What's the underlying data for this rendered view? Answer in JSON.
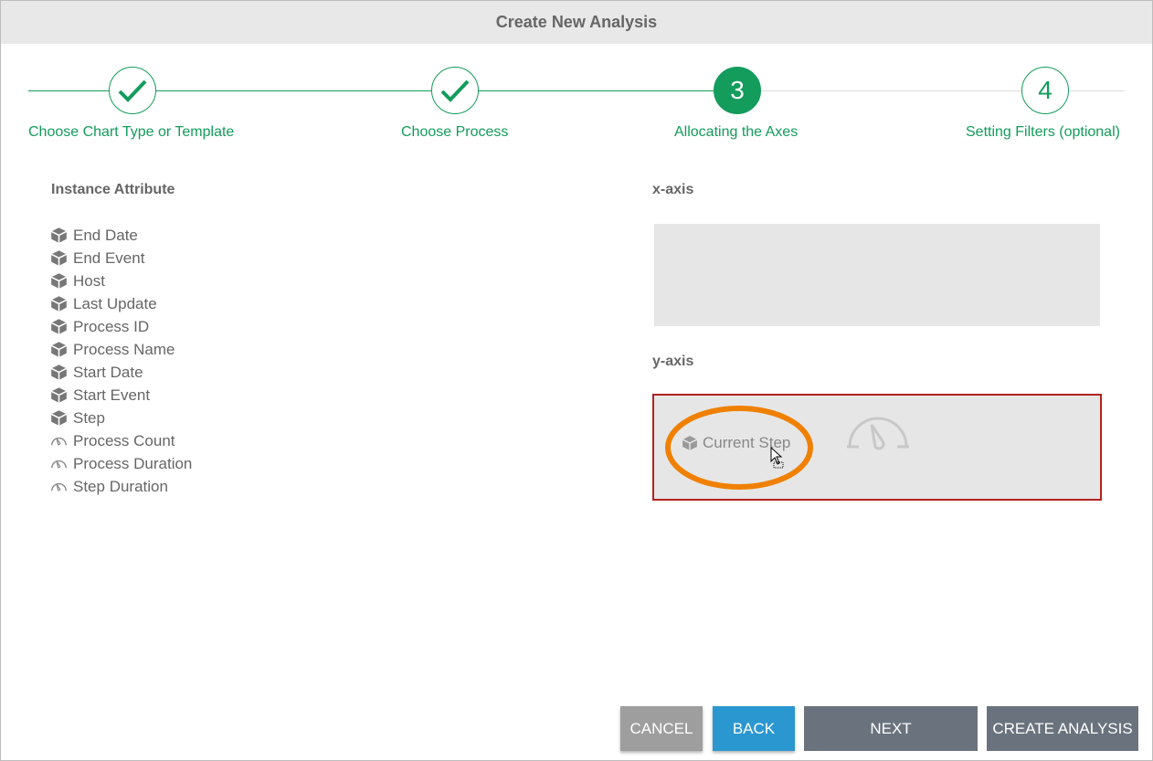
{
  "dialog": {
    "title": "Create New Analysis"
  },
  "stepper": {
    "steps": [
      {
        "label": "Choose Chart Type or Template",
        "state": "done",
        "icon": "check-icon"
      },
      {
        "label": "Choose Process",
        "state": "done",
        "icon": "check-icon"
      },
      {
        "label": "Allocating the Axes",
        "state": "active",
        "number": "3"
      },
      {
        "label": "Setting Filters (optional)",
        "state": "pending",
        "number": "4"
      }
    ],
    "accent": "#139c5b"
  },
  "attributes": {
    "heading": "Instance Attribute",
    "items": [
      {
        "label": "End Date",
        "icon": "cube-icon"
      },
      {
        "label": "End Event",
        "icon": "cube-icon"
      },
      {
        "label": "Host",
        "icon": "cube-icon"
      },
      {
        "label": "Last Update",
        "icon": "cube-icon"
      },
      {
        "label": "Process ID",
        "icon": "cube-icon"
      },
      {
        "label": "Process Name",
        "icon": "cube-icon"
      },
      {
        "label": "Start Date",
        "icon": "cube-icon"
      },
      {
        "label": "Start Event",
        "icon": "cube-icon"
      },
      {
        "label": "Step",
        "icon": "cube-icon"
      },
      {
        "label": "Process Count",
        "icon": "gauge-icon"
      },
      {
        "label": "Process Duration",
        "icon": "gauge-icon"
      },
      {
        "label": "Step Duration",
        "icon": "gauge-icon"
      }
    ]
  },
  "axes": {
    "x_label": "x-axis",
    "y_label": "y-axis",
    "y_dragged_item": "Current Step"
  },
  "buttons": {
    "cancel": "CANCEL",
    "back": "BACK",
    "next": "NEXT",
    "create": "CREATE ANALYSIS"
  }
}
